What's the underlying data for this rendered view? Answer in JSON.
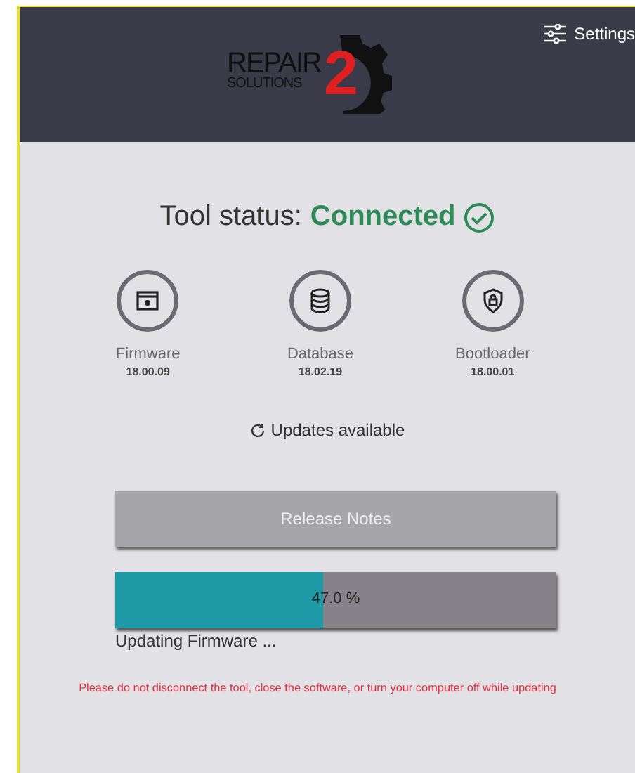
{
  "header": {
    "logo": {
      "word": "REPAIR",
      "subword": "SOLUTIONS",
      "numeral": "2"
    },
    "settings": {
      "label": "Settings"
    }
  },
  "tool_status": {
    "label": "Tool status:",
    "value": "Connected",
    "connected": true
  },
  "components": [
    {
      "kind": "firmware",
      "name": "Firmware",
      "version": "18.00.09"
    },
    {
      "kind": "database",
      "name": "Database",
      "version": "18.02.19"
    },
    {
      "kind": "bootloader",
      "name": "Bootloader",
      "version": "18.00.01"
    }
  ],
  "updates": {
    "label": "Updates available"
  },
  "release_notes_button": {
    "label": "Release Notes"
  },
  "progress": {
    "level": 0.47,
    "reading": "47.0 %",
    "caption": "Updating Firmware ..."
  },
  "warning": "Please do not disconnect the tool, close the software, or turn your computer off while updating"
}
